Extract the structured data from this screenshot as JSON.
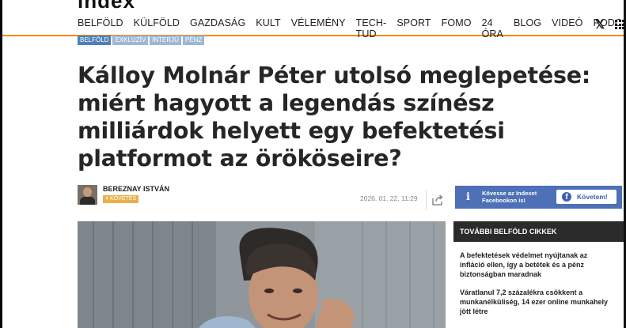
{
  "brand": {
    "logo": "index"
  },
  "nav": {
    "items": [
      "BELFÖLD",
      "KÜLFÖLD",
      "GAZDASÁG",
      "KULT",
      "VÉLEMÉNY",
      "TECH-TUD",
      "SPORT",
      "FOMO",
      "24 ÓRA",
      "BLOG",
      "VIDEÓ",
      "PODCAST"
    ],
    "x_icon": "x-icon",
    "menu_icon": "grid-menu-icon"
  },
  "tags": [
    "BELFÖLD",
    "EXKLUZÍV",
    "INTERJÚ",
    "PÉNZ"
  ],
  "article": {
    "title": "Kálloy Molnár Péter utolsó meglepetése: miért hagyott a legendás színész milliárdok helyett egy befektetési platformot az örököseire?",
    "author": "BEREZNAY ISTVÁN",
    "follow_label": "KÖVETÉS",
    "date": "2026. 01. 22. 11:29"
  },
  "facebook_box": {
    "text": "Kövesse az Indexet Facebookon is!",
    "button": "Követem!"
  },
  "sidebar": {
    "heading": "TOVÁBBI BELFÖLD CIKKEK",
    "items": [
      "A befektetések védelmet nyújtanak az infláció ellen, így a betétek és a pénz biztonságban maradnak",
      "Váratlanul 7,2 százalékra csökkent a munkanélküliség, 14  ezer online munkahely jött létre"
    ]
  },
  "colors": {
    "accent": "#f08b1d",
    "tag_primary": "#4f80b8",
    "facebook": "#4d70b7",
    "sidebar_head": "#2b2b2b"
  }
}
